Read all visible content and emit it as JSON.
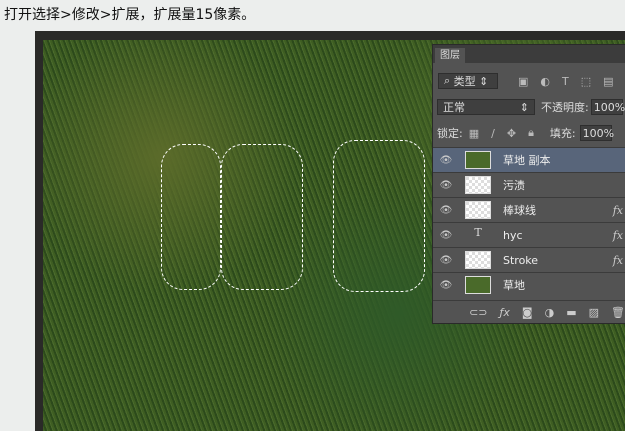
{
  "caption": "打开选择>修改>扩展，扩展量15像素。",
  "panel": {
    "tab": "图层",
    "filter_label": "类型",
    "blend_mode": "正常",
    "opacity_label": "不透明度:",
    "opacity": "100%",
    "lock_label": "锁定:",
    "fill_label": "填充:",
    "fill": "100%"
  },
  "layers": [
    {
      "name": "草地 副本",
      "thumb": "grass",
      "selected": true,
      "fx": false
    },
    {
      "name": "污渍",
      "thumb": "transparent",
      "fx": false
    },
    {
      "name": "棒球线",
      "thumb": "transparent",
      "fx": true
    },
    {
      "name": "hyc",
      "thumb": "text",
      "fx": true
    },
    {
      "name": "Stroke",
      "thumb": "transparent",
      "fx": true
    },
    {
      "name": "草地",
      "thumb": "grass",
      "fx": false
    }
  ],
  "fx_label": "fx",
  "text_thumb": "T"
}
